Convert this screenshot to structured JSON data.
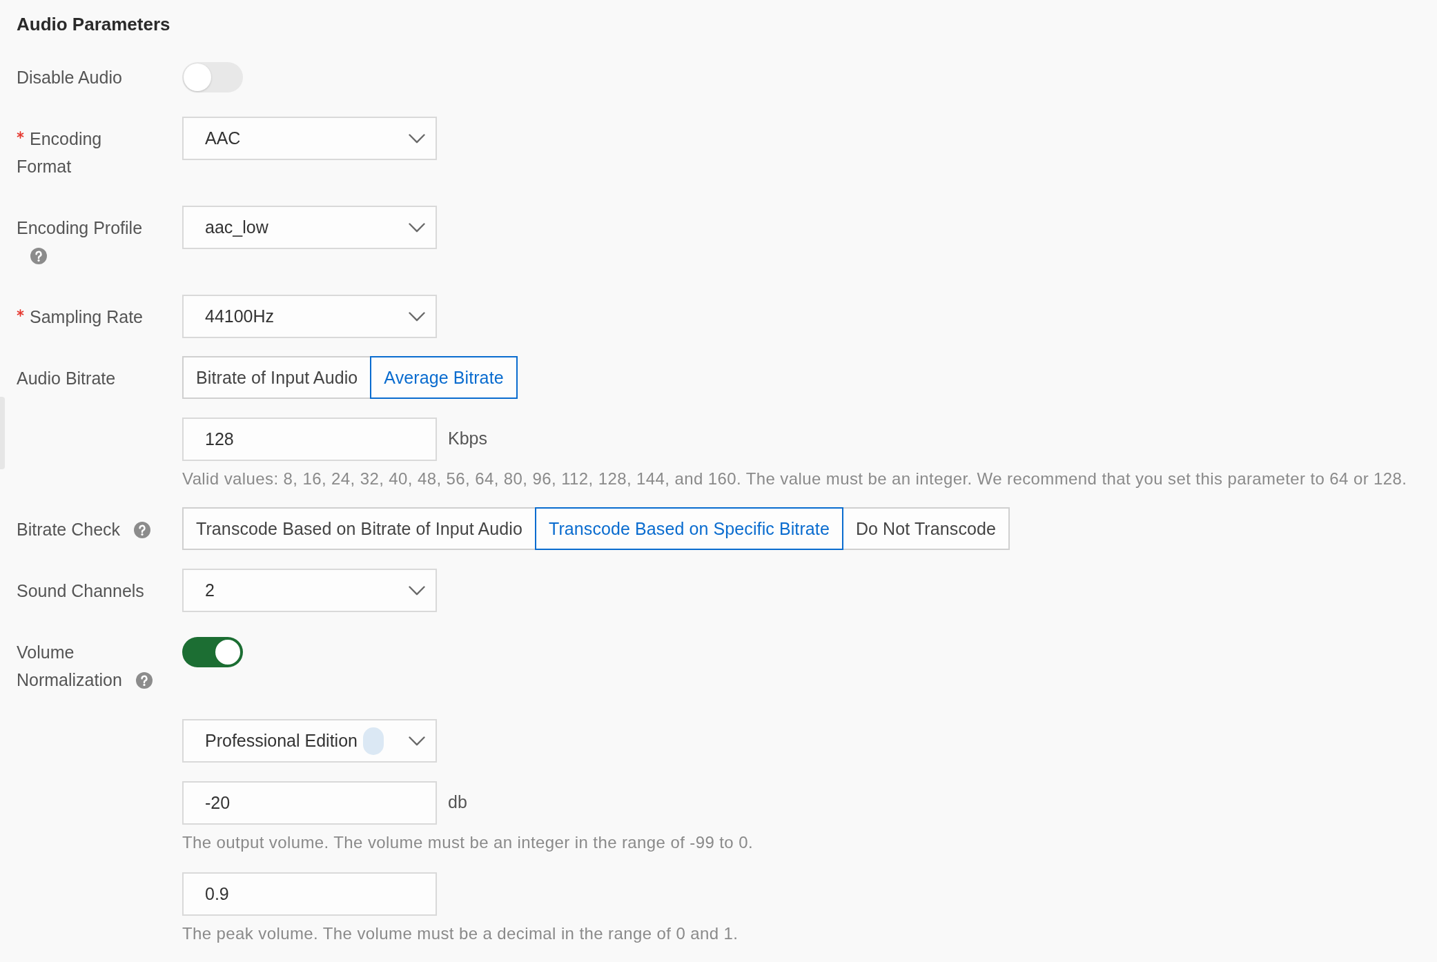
{
  "section": {
    "title": "Audio Parameters"
  },
  "fields": [
    {
      "kind": "switch",
      "label": "Disable Audio",
      "required": false,
      "help": false,
      "on": false
    },
    {
      "kind": "select",
      "label": "Encoding Format",
      "required": true,
      "help": false,
      "value": "AAC"
    },
    {
      "kind": "select",
      "label": "Encoding Profile",
      "required": false,
      "help": true,
      "value": "aac_low"
    },
    {
      "kind": "select",
      "label": "Sampling Rate",
      "required": true,
      "help": false,
      "value": "44100Hz"
    },
    {
      "kind": "segmented",
      "label": "Audio Bitrate",
      "required": false,
      "help": false,
      "options": [
        {
          "label": "Bitrate of Input Audio",
          "selected": false
        },
        {
          "label": "Average Bitrate",
          "selected": true
        }
      ],
      "sub_fields": [
        {
          "kind": "number",
          "value": "128",
          "unit": "Kbps",
          "hint": "Valid values: 8, 16, 24, 32, 40, 48, 56, 64, 80, 96, 112, 128, 144, and 160. The value must be an integer. We recommend that you set this parameter to 64 or 128."
        }
      ]
    },
    {
      "kind": "segmented",
      "label": "Bitrate Check",
      "required": false,
      "help": true,
      "options": [
        {
          "label": "Transcode Based on Bitrate of Input Audio",
          "selected": false
        },
        {
          "label": "Transcode Based on Specific Bitrate",
          "selected": true
        },
        {
          "label": "Do Not Transcode",
          "selected": false
        }
      ]
    },
    {
      "kind": "select",
      "label": "Sound Channels",
      "required": false,
      "help": false,
      "value": "2"
    },
    {
      "kind": "switch",
      "label": "Volume Normalization",
      "required": false,
      "help": true,
      "on": true,
      "sub_fields": [
        {
          "kind": "select",
          "value": "Professional Edition",
          "tag": true
        },
        {
          "kind": "number",
          "value": "-20",
          "unit": "db",
          "hint": "The output volume. The volume must be an integer in the range of -99 to 0."
        },
        {
          "kind": "number",
          "value": "0.9",
          "hint": "The peak volume. The volume must be a decimal in the range of 0 and 1."
        }
      ]
    }
  ]
}
